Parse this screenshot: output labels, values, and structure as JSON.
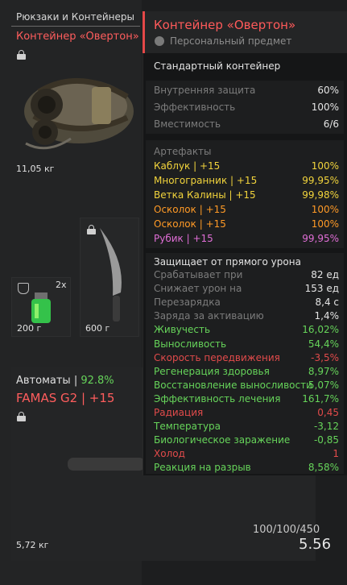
{
  "left": {
    "category_title": "Рюкзаки и Контейнеры",
    "item_name": "Контейнер «Овертон»",
    "item_weight": "11,05 кг",
    "slot_grenade": {
      "count": "2x",
      "weight": "200 г"
    },
    "slot_knife": {
      "weight": "600 г"
    }
  },
  "weapon": {
    "category": "Автоматы",
    "separator": " | ",
    "percent": "92.8%",
    "name": "FAMAS G2",
    "upgrade": " | +15",
    "durability": "100/100/450",
    "weight_value": "5.56",
    "weight": "5,72 кг"
  },
  "tooltip": {
    "title": "Контейнер «Овертон»",
    "subtitle": "Персональный предмет",
    "type": "Стандартный контейнер",
    "stats": [
      {
        "label": "Внутренняя защита",
        "value": "60%"
      },
      {
        "label": "Эффективность",
        "value": "100%"
      },
      {
        "label": "Вместимость",
        "value": "6/6"
      }
    ],
    "artifacts_title": "Артефакты",
    "artifacts": [
      {
        "label": "Каблук | +15",
        "value": "100%",
        "color": "#f2d43c"
      },
      {
        "label": "Многогранник | +15",
        "value": "99,95%",
        "color": "#f2d43c"
      },
      {
        "label": "Ветка Калины | +15",
        "value": "99,98%",
        "color": "#f2d43c"
      },
      {
        "label": "Осколок | +15",
        "value": "100%",
        "color": "#ff9a26"
      },
      {
        "label": "Осколок | +15",
        "value": "100%",
        "color": "#ff9a26"
      },
      {
        "label": "Рубик | +15",
        "value": "99,95%",
        "color": "#e06ed6"
      }
    ],
    "protection_title": "Защищает от прямого урона",
    "protection": [
      {
        "label": "Срабатывает при",
        "value": "82 ед",
        "cls": "grey",
        "vcls": "white"
      },
      {
        "label": "Снижает урон на",
        "value": "153 ед",
        "cls": "grey",
        "vcls": "white"
      },
      {
        "label": "Перезарядка",
        "value": "8,4 с",
        "cls": "grey",
        "vcls": "white"
      },
      {
        "label": "Заряда за активацию",
        "value": "1,4%",
        "cls": "grey",
        "vcls": "white"
      }
    ],
    "effects": [
      {
        "label": "Живучесть",
        "value": "16,02%",
        "cls": "green",
        "vcls": "green"
      },
      {
        "label": "Выносливость",
        "value": "54,4%",
        "cls": "green",
        "vcls": "green"
      },
      {
        "label": "Скорость передвижения",
        "value": "-3,5%",
        "cls": "red",
        "vcls": "red"
      },
      {
        "label": "Регенерация здоровья",
        "value": "8,97%",
        "cls": "green",
        "vcls": "green"
      },
      {
        "label": "Восстановление выносливости",
        "value": "5,07%",
        "cls": "green",
        "vcls": "green"
      },
      {
        "label": "Эффективность лечения",
        "value": "161,7%",
        "cls": "green",
        "vcls": "green"
      },
      {
        "label": "Радиация",
        "value": "0,45",
        "cls": "red",
        "vcls": "red"
      },
      {
        "label": "Температура",
        "value": "-3,12",
        "cls": "green",
        "vcls": "green"
      },
      {
        "label": "Биологическое заражение",
        "value": "-0,85",
        "cls": "green",
        "vcls": "green"
      },
      {
        "label": "Холод",
        "value": "1",
        "cls": "red",
        "vcls": "red"
      },
      {
        "label": "Реакция на разрыв",
        "value": "8,58%",
        "cls": "green",
        "vcls": "green"
      }
    ]
  }
}
